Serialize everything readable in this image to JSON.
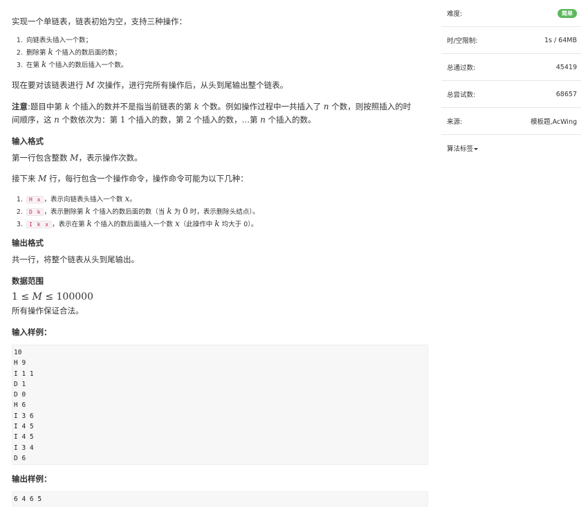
{
  "problem": {
    "intro": "实现一个单链表，链表初始为空，支持三种操作：",
    "ops": [
      [
        "向链表头插入一个数；"
      ],
      [
        "删除第 ",
        "k",
        " 个插入的数后面的数；"
      ],
      [
        "在第 ",
        "k",
        " 个插入的数后插入一个数。"
      ]
    ],
    "task_a": "现在要对该链表进行 ",
    "task_m": "M",
    "task_b": " 次操作，进行完所有操作后，从头到尾输出整个链表。",
    "note_label": "注意",
    "note_l1a": ":题目中第 ",
    "note_k1": "k",
    "note_l1b": " 个插入的数并不是指当前链表的第 ",
    "note_k2": "k",
    "note_l1c": " 个数。例如操作过程中一共插入了 ",
    "note_n1": "n",
    "note_l1d": " 个数，则按照插入的时",
    "note_l2a": "间顺序，这 ",
    "note_n2": "n",
    "note_l2b": " 个数依次为：第 ",
    "note_one": "1",
    "note_l2c": " 个插入的数，第 ",
    "note_two": "2",
    "note_l2d": " 个插入的数，…第 ",
    "note_n3": "n",
    "note_l2e": " 个插入的数。"
  },
  "input_format": {
    "title": "输入格式",
    "l1a": "第一行包含整数 ",
    "l1m": "M",
    "l1b": "，表示操作次数。",
    "l2a": "接下来 ",
    "l2m": "M",
    "l2b": " 行，每行包含一个操作命令，操作命令可能为以下几种：",
    "items": [
      {
        "code": "H x",
        "a": "，表示向链表头插入一个数 ",
        "m1": "x",
        "b": "。",
        "m2": "",
        "c": "",
        "m3": "",
        "d": ""
      },
      {
        "code": "D k",
        "a": "，表示删除第 ",
        "m1": "k",
        "b": " 个插入的数后面的数（当 ",
        "m2": "k",
        "c": " 为 ",
        "m3": "0",
        "d": " 时，表示删除头结点）。"
      },
      {
        "code": "I k x",
        "a": "，表示在第 ",
        "m1": "k",
        "b": " 个插入的数后面插入一个数 ",
        "m2": "x",
        "c": "（此操作中 ",
        "m3": "k",
        "d": " 均大于 0）。"
      }
    ]
  },
  "output_format": {
    "title": "输出格式",
    "text": "共一行，将整个链表从头到尾输出。"
  },
  "range": {
    "title": "数据范围",
    "formula_1": "1 ≤ ",
    "formula_m": "M",
    "formula_2": " ≤ 100000",
    "text": "所有操作保证合法。"
  },
  "sample_input": {
    "title": "输入样例：",
    "code": "10\nH 9\nI 1 1\nD 1\nD 0\nH 6\nI 3 6\nI 4 5\nI 4 5\nI 3 4\nD 6"
  },
  "sample_output": {
    "title": "输出样例：",
    "code": "6 4 6 5"
  },
  "sidebar": {
    "difficulty_label": "难度:",
    "difficulty_value": "简单",
    "limit_label": "时/空限制:",
    "limit_value": "1s / 64MB",
    "passed_label": "总通过数:",
    "passed_value": "45419",
    "attempts_label": "总尝试数:",
    "attempts_value": "68657",
    "source_label": "来源:",
    "source_value": "模板题,AcWing",
    "tags_label": "算法标签"
  },
  "colors": {
    "badge_green": "#5cb85c",
    "code_red": "#c7254e",
    "code_bg": "#f7f7f7"
  }
}
